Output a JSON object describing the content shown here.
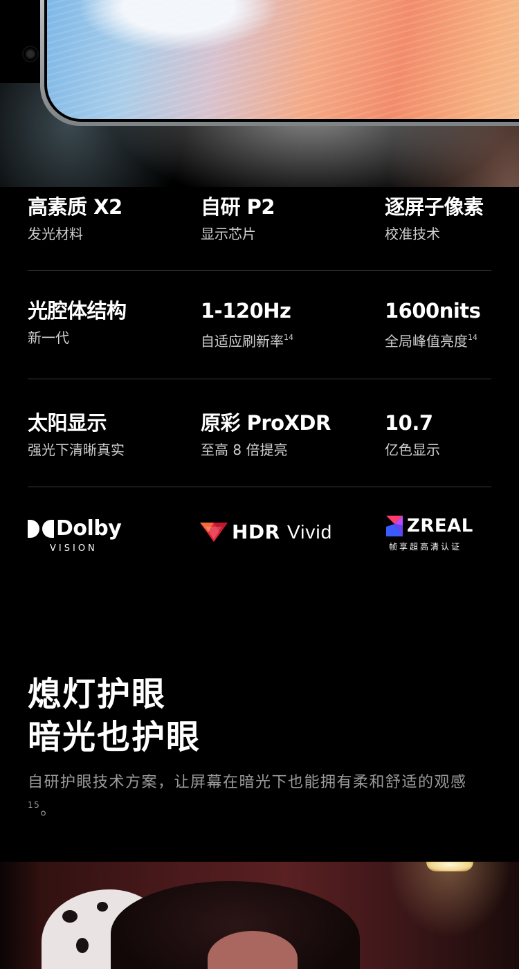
{
  "specs": [
    [
      {
        "title": "高素质 X2",
        "sub": "发光材料",
        "sup": ""
      },
      {
        "title": "自研 P2",
        "sub": "显示芯片",
        "sup": ""
      },
      {
        "title": "逐屏子像素",
        "sub": "校准技术",
        "sup": ""
      }
    ],
    [
      {
        "title": "光腔体结构",
        "sub": "新一代",
        "sup": ""
      },
      {
        "title": "1-120Hz",
        "sub": "自适应刷新率",
        "sup": "14"
      },
      {
        "title": "1600nits",
        "sub": "全局峰值亮度",
        "sup": "14"
      }
    ],
    [
      {
        "title": "太阳显示",
        "sub": "强光下清晰真实",
        "sup": ""
      },
      {
        "title": "原彩 ProXDR",
        "sub": "至高 8 倍提亮",
        "sup": ""
      },
      {
        "title": "10.7",
        "sub": "亿色显示",
        "sup": ""
      }
    ]
  ],
  "logos": {
    "dolby": {
      "name": "Dolby",
      "sub": "VISION"
    },
    "hdr": {
      "bold": "HDR",
      "light": "Vivid"
    },
    "zreal": {
      "name": "ZREAL",
      "sub": "帧享超高清认证"
    }
  },
  "headline": {
    "line1": "熄灯护眼",
    "line2": "暗光也护眼"
  },
  "body": {
    "text": "自研护眼技术方案，让屏幕在暗光下也能拥有柔和舒适的观感",
    "sup": "15",
    "end": "。"
  },
  "colors": {
    "background": "#000000",
    "divider": "#3a3a3a",
    "muted": "#9a9a9a"
  }
}
